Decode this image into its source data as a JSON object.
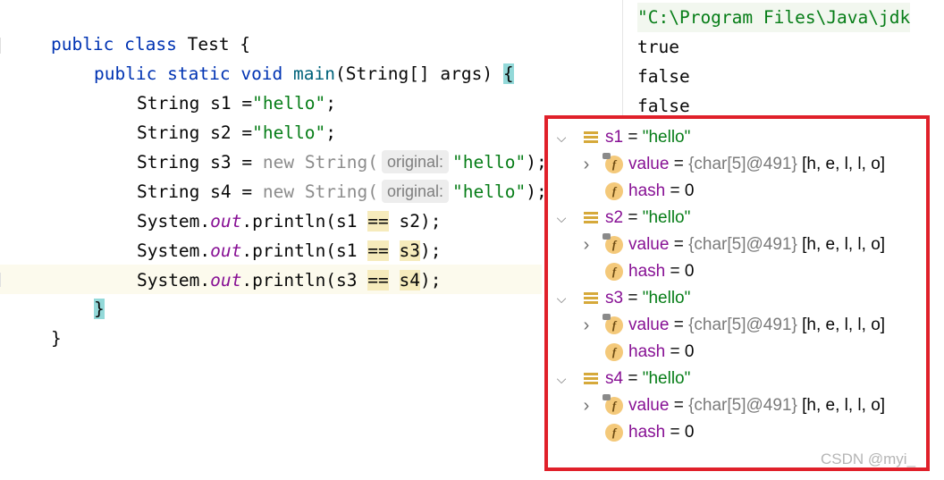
{
  "editor": {
    "line1": {
      "kw": "public class",
      "rest": " Test {"
    },
    "line2": {
      "kw": "public static void",
      "method": "main",
      "rest": "(String[] args) ",
      "brace": "{"
    },
    "line3": {
      "type": "String s1 =",
      "str": "\"hello\"",
      "end": ";"
    },
    "line4": {
      "type": "String s2 =",
      "str": "\"hello\"",
      "end": ";"
    },
    "line5": {
      "type": "String s3 = ",
      "new": "new String(",
      "hint": "original:",
      "str": "\"hello\"",
      "end": ");"
    },
    "line6": {
      "type": "String s4 = ",
      "new": "new String(",
      "hint": "original:",
      "str": "\"hello\"",
      "end": ");"
    },
    "line7": {
      "pre": "System.",
      "field": "out",
      "call": ".println(s1 ",
      "op": "==",
      "arg": "s2",
      "end": ");"
    },
    "line8": {
      "pre": "System.",
      "field": "out",
      "call": ".println(s1 ",
      "op": "==",
      "arg": "s3",
      "end": ");"
    },
    "line9": {
      "pre": "System.",
      "field": "out",
      "call": ".println(s3 ",
      "op": "==",
      "arg": "s4",
      "end": ");"
    },
    "line10": {
      "brace": "}"
    },
    "line11": {
      "brace": "}"
    }
  },
  "console": {
    "command": "\"C:\\Program Files\\Java\\jdk",
    "outputs": [
      "true",
      "false",
      "false"
    ]
  },
  "debugger": {
    "variables": [
      {
        "name": "s1",
        "value": "\"hello\"",
        "children": [
          {
            "name": "value",
            "ref": "{char[5]@491}",
            "detail": "[h, e, l, l, o]"
          },
          {
            "name": "hash",
            "plain": "0"
          }
        ]
      },
      {
        "name": "s2",
        "value": "\"hello\"",
        "children": [
          {
            "name": "value",
            "ref": "{char[5]@491}",
            "detail": "[h, e, l, l, o]"
          },
          {
            "name": "hash",
            "plain": "0"
          }
        ]
      },
      {
        "name": "s3",
        "value": "\"hello\"",
        "children": [
          {
            "name": "value",
            "ref": "{char[5]@491}",
            "detail": "[h, e, l, l, o]"
          },
          {
            "name": "hash",
            "plain": "0"
          }
        ]
      },
      {
        "name": "s4",
        "value": "\"hello\"",
        "children": [
          {
            "name": "value",
            "ref": "{char[5]@491}",
            "detail": "[h, e, l, l, o]"
          },
          {
            "name": "hash",
            "plain": "0"
          }
        ]
      }
    ],
    "equals": " = ",
    "field_letter": "f",
    "expanded_glyph": "⌵",
    "collapsed_glyph": "›"
  },
  "watermark": "CSDN @myi_",
  "colors": {
    "highlight_border": "#e0202a",
    "keyword": "#0033b3",
    "string": "#067d17",
    "field_name": "#871094"
  }
}
